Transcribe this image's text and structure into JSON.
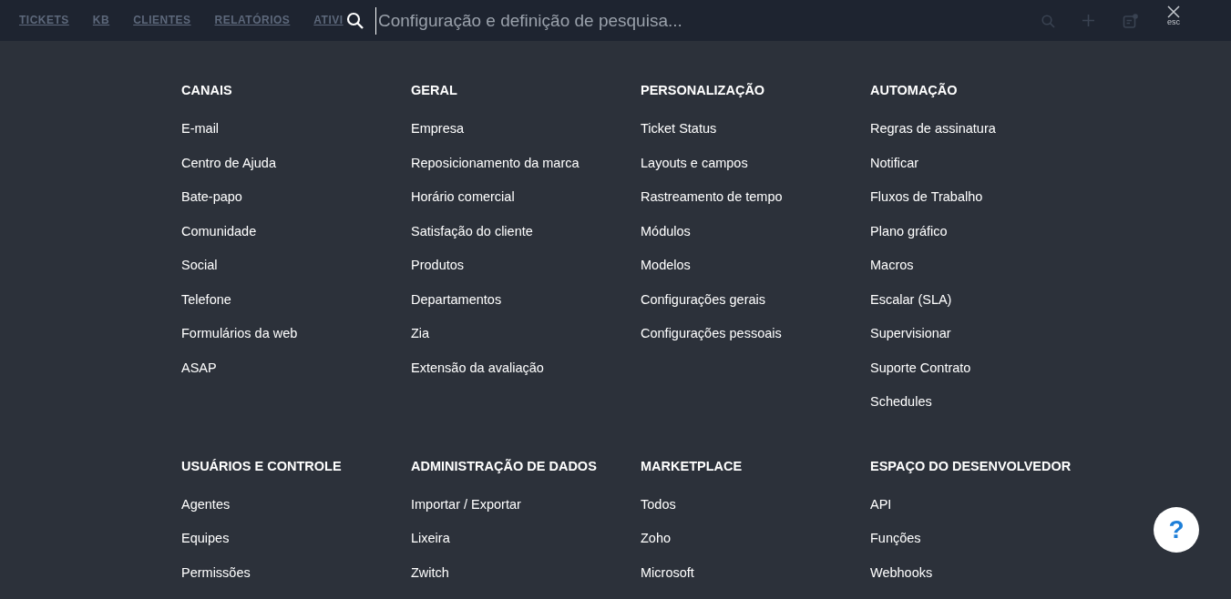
{
  "topbar": {
    "tabs": [
      "TICKETS",
      "KB",
      "CLIENTES",
      "RELATÓRIOS",
      "ATIVI"
    ],
    "search": {
      "placeholder": "Configuração e definição de pesquisa..."
    },
    "close_label": "esc"
  },
  "sections": [
    {
      "title": "CANAIS",
      "items": [
        "E-mail",
        "Centro de Ajuda",
        "Bate-papo",
        "Comunidade",
        "Social",
        "Telefone",
        "Formulários da web",
        "ASAP"
      ]
    },
    {
      "title": "GERAL",
      "items": [
        "Empresa",
        "Reposicionamento da marca",
        "Horário comercial",
        "Satisfação do cliente",
        "Produtos",
        "Departamentos",
        "Zia",
        "Extensão da avaliação"
      ]
    },
    {
      "title": "PERSONALIZAÇÃO",
      "items": [
        "Ticket Status",
        "Layouts e campos",
        "Rastreamento de tempo",
        "Módulos",
        "Modelos",
        "Configurações gerais",
        "Configurações pessoais"
      ]
    },
    {
      "title": "AUTOMAÇÃO",
      "items": [
        "Regras de assinatura",
        "Notificar",
        "Fluxos de Trabalho",
        "Plano gráfico",
        "Macros",
        "Escalar (SLA)",
        "Supervisionar",
        "Suporte Contrato",
        "Schedules"
      ]
    },
    {
      "title": "USUÁRIOS E CONTROLE",
      "items": [
        "Agentes",
        "Equipes",
        "Permissões"
      ]
    },
    {
      "title": "ADMINISTRAÇÃO DE DADOS",
      "items": [
        "Importar / Exportar",
        "Lixeira",
        "Zwitch"
      ]
    },
    {
      "title": "MARKETPLACE",
      "items": [
        "Todos",
        "Zoho",
        "Microsoft"
      ]
    },
    {
      "title": "ESPAÇO DO DESENVOLVEDOR",
      "items": [
        "API",
        "Funções",
        "Webhooks"
      ]
    }
  ],
  "help_button": "?"
}
